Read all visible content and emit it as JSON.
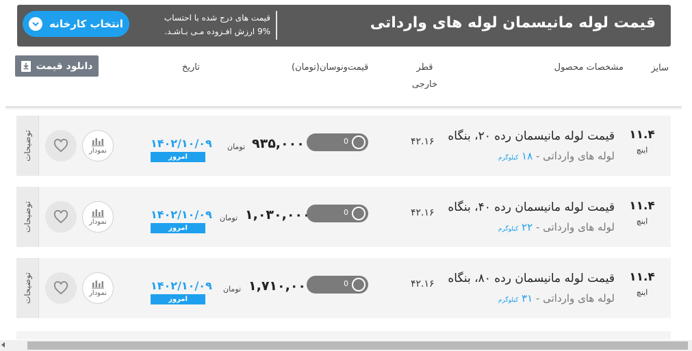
{
  "header": {
    "title": "قیمت لوله مانیسمان لوله های وارداتی",
    "note_line1": "قیمت های درج شده با احتساب",
    "note_line2": "9% ارزش افـزوده مـی بـاشـد.",
    "factory_button": "انتخاب کارخانه"
  },
  "columns": {
    "size": "سایز",
    "specs": "مشخصات محصول",
    "diameter_line1": "قطر",
    "diameter_line2": "خارجی",
    "price_fluctuation": "قیمت‌ونوسان(تومان)",
    "date": "تاریخ"
  },
  "download_button": "دانلود قیمت",
  "rows": [
    {
      "size": "۱۱.۴",
      "size_unit": "اینچ",
      "name": "قیمت لوله مانیسمان رده ۲۰، بنگاه",
      "sub": "لوله های وارداتی - ",
      "weight_value": "۱۸",
      "weight_unit": "کیلوگرم",
      "diameter": "۴۲.۱۶",
      "toggle_value": "0",
      "price": "۹۳۵,۰۰۰",
      "currency": "تومان",
      "date": "۱۴۰۲/۱۰/۰۹",
      "today": "امروز",
      "chart_label": "نمودار",
      "desc_tab": "توضیحات"
    },
    {
      "size": "۱۱.۴",
      "size_unit": "اینچ",
      "name": "قیمت لوله مانیسمان رده ۴۰، بنگاه",
      "sub": "لوله های وارداتی - ",
      "weight_value": "۲۲",
      "weight_unit": "کیلوگرم",
      "diameter": "۴۲.۱۶",
      "toggle_value": "0",
      "price": "۱,۰۳۰,۰۰۰",
      "currency": "تومان",
      "date": "۱۴۰۲/۱۰/۰۹",
      "today": "امروز",
      "chart_label": "نمودار",
      "desc_tab": "توضیحات"
    },
    {
      "size": "۱۱.۴",
      "size_unit": "اینچ",
      "name": "قیمت لوله مانیسمان رده ۸۰، بنگاه",
      "sub": "لوله های وارداتی - ",
      "weight_value": "۳۱",
      "weight_unit": "کیلوگرم",
      "diameter": "۴۲.۱۶",
      "toggle_value": "0",
      "price": "۱,۷۱۰,۰۰۰",
      "currency": "تومان",
      "date": "۱۴۰۲/۱۰/۰۹",
      "today": "امروز",
      "chart_label": "نمودار",
      "desc_tab": "توضیحات"
    }
  ],
  "colors": {
    "header_bg": "#5a5a5a",
    "accent": "#1fa0ee",
    "row_bg": "#f4f4f4",
    "toggle_bg": "#7b7b7b",
    "download_bg": "#737c86"
  },
  "icons": {
    "factory_chevron": "chevron-down-icon",
    "download": "download-icon",
    "favorite": "heart-icon",
    "chart": "bar-chart-icon"
  }
}
